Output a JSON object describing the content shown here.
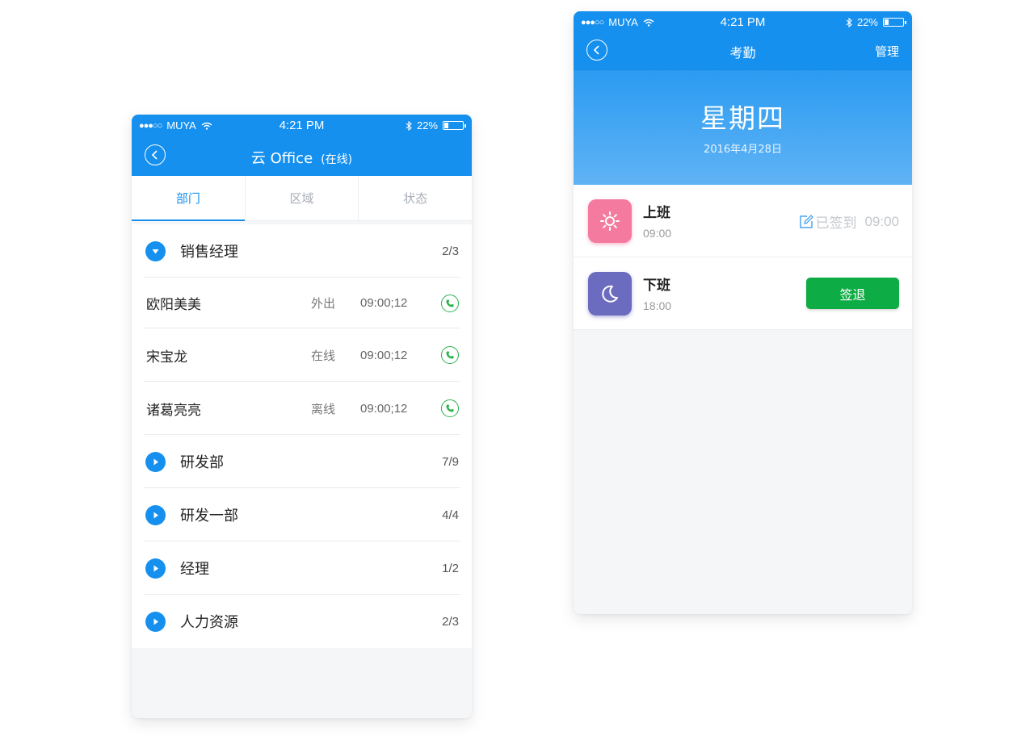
{
  "left_phone": {
    "status_bar": {
      "carrier": "MUYA",
      "time": "4:21 PM",
      "battery": "22%"
    },
    "header": {
      "title": "云 Office",
      "subtitle": "(在线)"
    },
    "tabs": [
      {
        "label": "部门",
        "active": true
      },
      {
        "label": "区域",
        "active": false
      },
      {
        "label": "状态",
        "active": false
      }
    ],
    "list": [
      {
        "type": "dept",
        "name": "销售经理",
        "count": "2/3",
        "expanded": true
      },
      {
        "type": "person",
        "name": "欧阳美美",
        "status": "外出",
        "time": "09:00;12"
      },
      {
        "type": "person",
        "name": "宋宝龙",
        "status": "在线",
        "time": "09:00;12"
      },
      {
        "type": "person",
        "name": "诸葛亮亮",
        "status": "离线",
        "time": "09:00;12"
      },
      {
        "type": "dept",
        "name": "研发部",
        "count": "7/9",
        "expanded": false
      },
      {
        "type": "dept",
        "name": "研发一部",
        "count": "4/4",
        "expanded": false
      },
      {
        "type": "dept",
        "name": "经理",
        "count": "1/2",
        "expanded": false
      },
      {
        "type": "dept",
        "name": "人力资源",
        "count": "2/3",
        "expanded": false
      }
    ]
  },
  "right_phone": {
    "status_bar": {
      "carrier": "MUYA",
      "time": "4:21 PM",
      "battery": "22%"
    },
    "header": {
      "title": "考勤",
      "manage_label": "管理",
      "weekday": "星期四",
      "date": "2016年4月28日"
    },
    "attendance": {
      "on_duty": {
        "label": "上班",
        "time": "09:00",
        "signed_label": "已签到",
        "signed_time": "09:00"
      },
      "off_duty": {
        "label": "下班",
        "time": "18:00",
        "button_label": "签退"
      }
    }
  },
  "colors": {
    "primary": "#1590ef",
    "green": "#0eac44",
    "pink": "#f47aa0",
    "purple": "#6b6cbf"
  },
  "battery_level": 0.22
}
